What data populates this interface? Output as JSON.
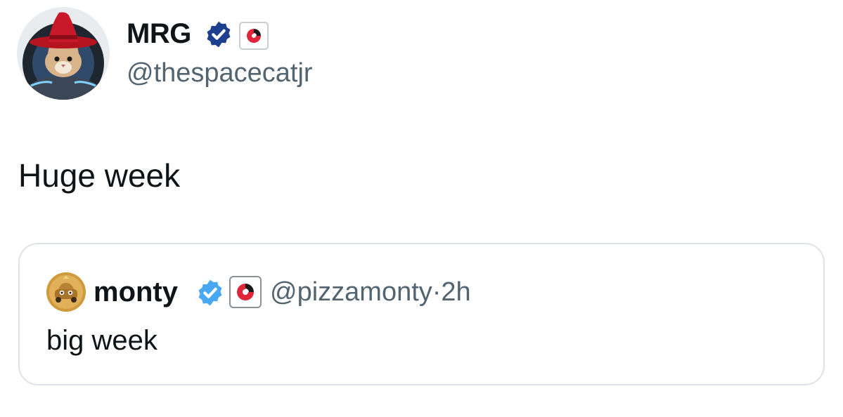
{
  "author": {
    "display_name": "MRG",
    "handle": "@thespacecatjr",
    "avatar_icon": "space-cat-wizard-avatar-icon",
    "verified_badge_color": "#1d3f8f"
  },
  "tweet": {
    "text": "Huge week"
  },
  "quoted_tweet": {
    "display_name": "monty",
    "handle": "@pizzamonty",
    "separator": "·",
    "time": "2h",
    "text": "big week",
    "avatar_icon": "gold-car-avatar-icon",
    "verified_badge_color": "#4aa8f2"
  },
  "colors": {
    "text_primary": "#0f1419",
    "text_secondary": "#536471",
    "border": "#dfe3e6",
    "affiliate_red": "#e0263b"
  }
}
